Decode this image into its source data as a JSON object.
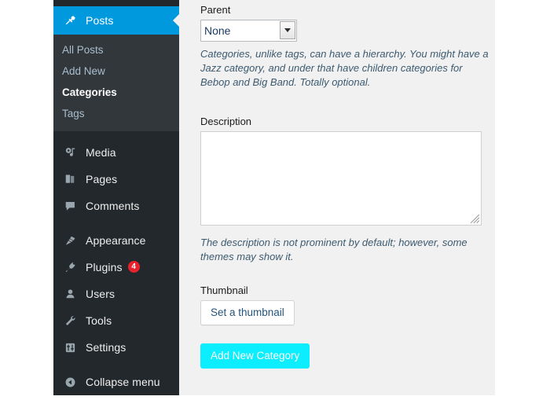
{
  "sidebar": {
    "active_item": {
      "label": "Posts",
      "icon": "pin-icon"
    },
    "submenu": [
      {
        "label": "All Posts",
        "current": false
      },
      {
        "label": "Add New",
        "current": false
      },
      {
        "label": "Categories",
        "current": true
      },
      {
        "label": "Tags",
        "current": false
      }
    ],
    "items": [
      {
        "label": "Media",
        "icon": "media-icon",
        "badge": ""
      },
      {
        "label": "Pages",
        "icon": "pages-icon",
        "badge": ""
      },
      {
        "label": "Comments",
        "icon": "comments-icon",
        "badge": ""
      },
      {
        "label": "Appearance",
        "icon": "paintbrush-icon",
        "badge": ""
      },
      {
        "label": "Plugins",
        "icon": "plug-icon",
        "badge": "4"
      },
      {
        "label": "Users",
        "icon": "user-icon",
        "badge": ""
      },
      {
        "label": "Tools",
        "icon": "wrench-icon",
        "badge": ""
      },
      {
        "label": "Settings",
        "icon": "sliders-icon",
        "badge": ""
      }
    ],
    "collapse": {
      "label": "Collapse menu",
      "icon": "arrow-left-circle-icon"
    },
    "colors": {
      "background": "#23282d",
      "submenu_background": "#32373c",
      "active_background": "#0099dd",
      "badge_background": "#e8222c"
    }
  },
  "form": {
    "parent": {
      "label": "Parent",
      "selected": "None",
      "options": [
        "None"
      ],
      "help": "Categories, unlike tags, can have a hierarchy. You might have a Jazz category, and under that have children categories for Bebop and Big Band. Totally optional."
    },
    "description": {
      "label": "Description",
      "value": "",
      "placeholder": "",
      "help": "The description is not prominent by default; however, some themes may show it."
    },
    "thumbnail": {
      "label": "Thumbnail",
      "button_label": "Set a thumbnail"
    },
    "submit": {
      "label": "Add New Category",
      "color": "#0ceefd"
    }
  }
}
